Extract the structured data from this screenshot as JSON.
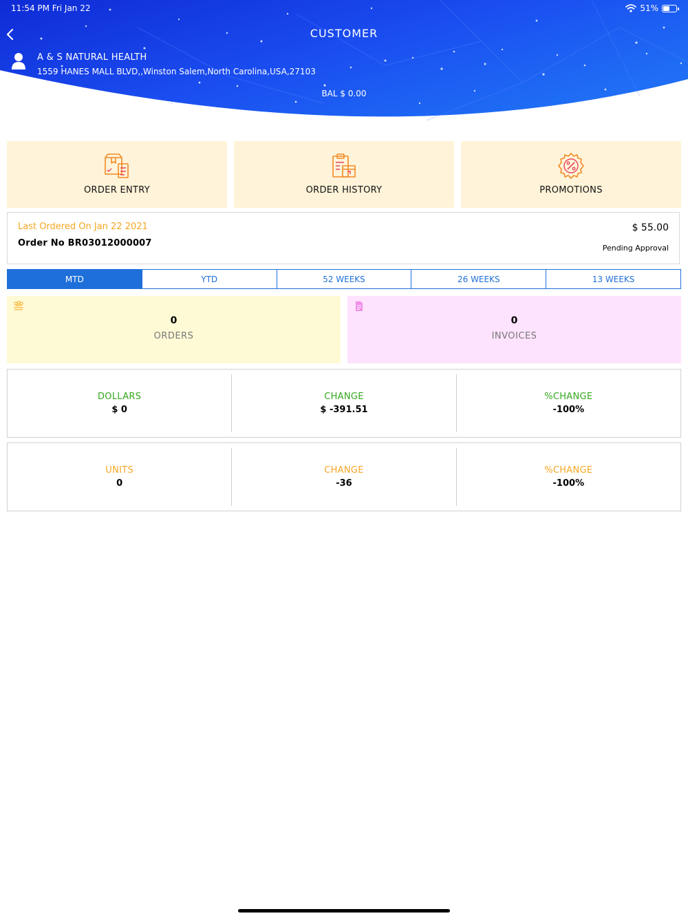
{
  "status_bar": {
    "time_date": "11:54 PM   Fri Jan 22",
    "battery_text": "51%",
    "battery_level": 0.51
  },
  "header": {
    "title": "CUSTOMER",
    "customer_name": "A & S NATURAL HEALTH",
    "customer_address": "1559 HANES MALL BLVD,,Winston Salem,North Carolina,USA,27103",
    "balance": "BAL $ 0.00"
  },
  "actions": [
    {
      "label": "ORDER ENTRY",
      "icon": "order-entry-icon"
    },
    {
      "label": "ORDER HISTORY",
      "icon": "order-history-icon"
    },
    {
      "label": "PROMOTIONS",
      "icon": "promotions-icon"
    }
  ],
  "last_order": {
    "ordered_on": "Last Ordered On Jan 22 2021",
    "order_no": "Order No BR03012000007",
    "amount": "$ 55.00",
    "status": "Pending Approval"
  },
  "period_tabs": [
    {
      "label": "MTD",
      "active": true
    },
    {
      "label": "YTD",
      "active": false
    },
    {
      "label": "52 WEEKS",
      "active": false
    },
    {
      "label": "26 WEEKS",
      "active": false
    },
    {
      "label": "13 WEEKS",
      "active": false
    }
  ],
  "summary": {
    "orders": {
      "value": "0",
      "label": "ORDERS",
      "icon": "orders-icon",
      "bg": "#fffad6"
    },
    "invoices": {
      "value": "0",
      "label": "INVOICES",
      "icon": "invoice-icon",
      "bg": "#fde3fd"
    }
  },
  "dollars_row": {
    "color": "#34a81f",
    "cells": [
      {
        "label": "DOLLARS",
        "value": "$ 0"
      },
      {
        "label": "CHANGE",
        "value": "$ -391.51"
      },
      {
        "label": "%CHANGE",
        "value": "-100%"
      }
    ]
  },
  "units_row": {
    "color": "#f5a623",
    "cells": [
      {
        "label": "UNITS",
        "value": "0"
      },
      {
        "label": "CHANGE",
        "value": "-36"
      },
      {
        "label": "%CHANGE",
        "value": "-100%"
      }
    ]
  },
  "colors": {
    "accent": "#1e6fd9",
    "header_blue": "#1240e8",
    "tile_bg": "#fff3d9",
    "icon_orange": "#f08a24"
  }
}
